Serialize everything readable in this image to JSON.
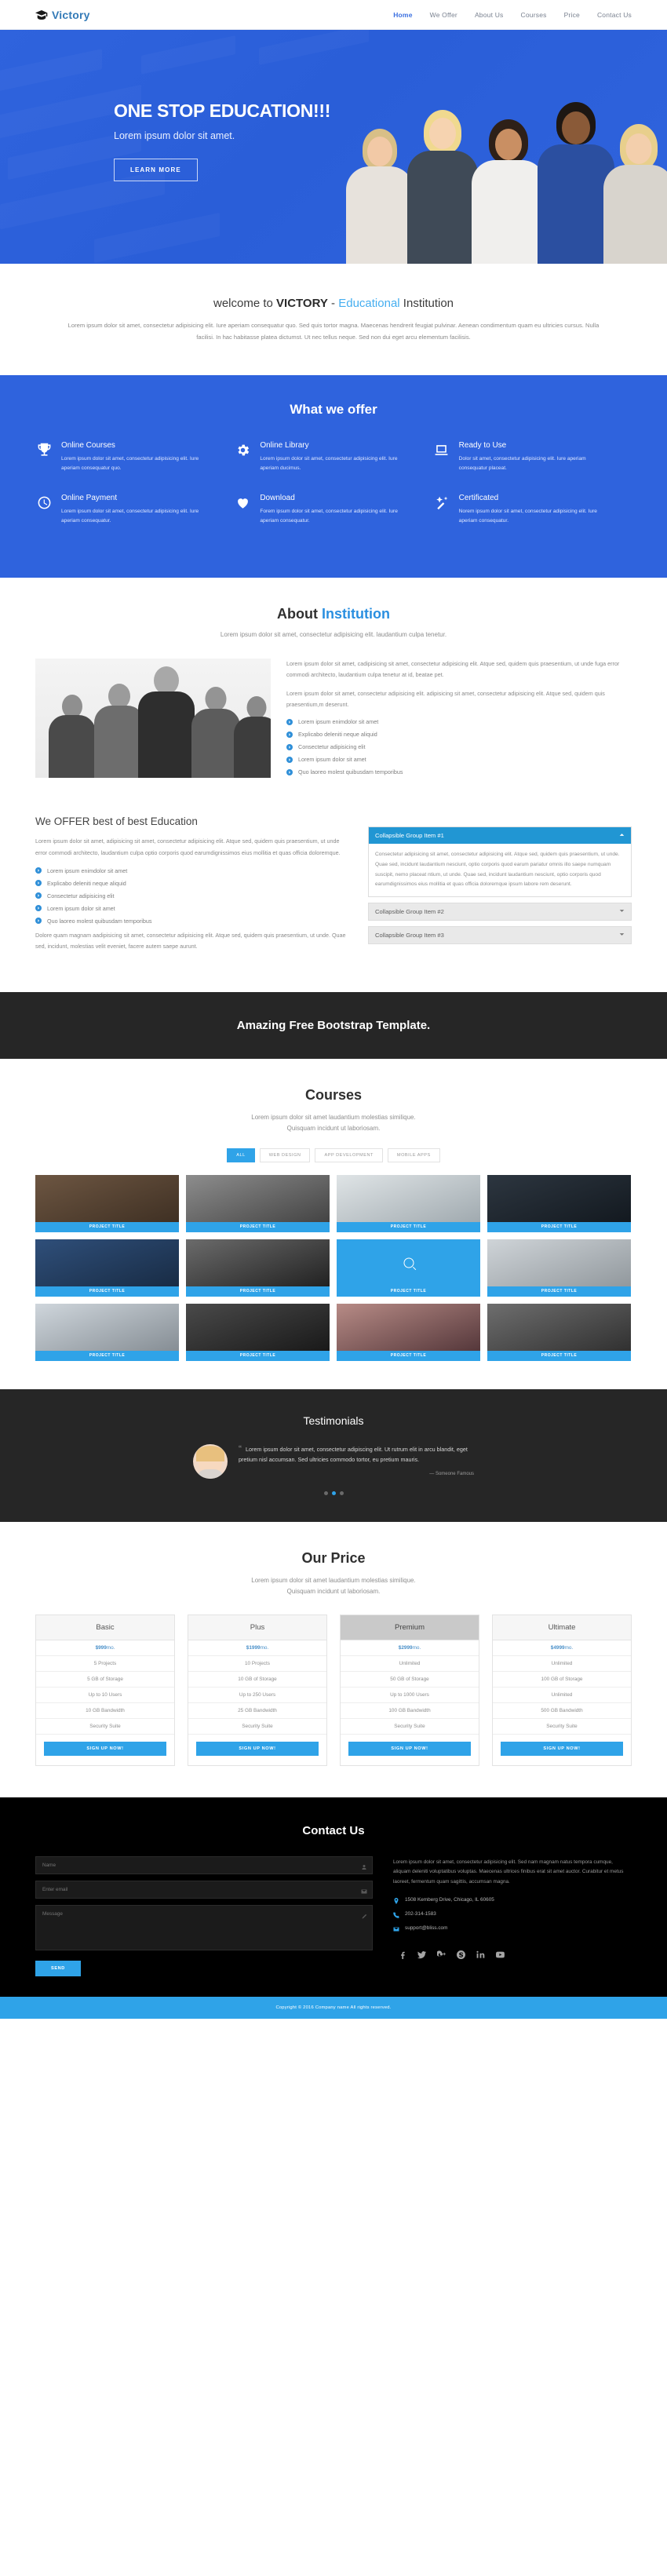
{
  "nav": {
    "brand": "Victory",
    "brand_icon": "graduation-cap-icon",
    "links": [
      {
        "label": "Home",
        "active": true
      },
      {
        "label": "We Offer",
        "active": false
      },
      {
        "label": "About Us",
        "active": false
      },
      {
        "label": "Courses",
        "active": false
      },
      {
        "label": "Price",
        "active": false
      },
      {
        "label": "Contact Us",
        "active": false
      }
    ]
  },
  "hero": {
    "title": "ONE STOP EDUCATION!!!",
    "subtitle": "Lorem ipsum dolor sit amet.",
    "button": "LEARN MORE",
    "bg_color": "#2f63dd"
  },
  "welcome": {
    "title_pre": "welcome to ",
    "title_bold": "VICTORY",
    "title_dash": " - ",
    "title_accent": "Educational",
    "title_post": " Institution",
    "paragraph": "Lorem ipsum dolor sit amet, consectetur adipisicing elit. Iure aperiam consequatur quo. Sed quis tortor magna. Maecenas hendrerit feugiat pulvinar. Aenean condimentum quam eu ultricies cursus. Nulla facilisi. In hac habitasse platea dictumst. Ut nec tellus neque. Sed non dui eget arcu elementum facilisis."
  },
  "offer": {
    "title": "What we offer",
    "items": [
      {
        "icon": "trophy-icon",
        "title": "Online Courses",
        "text": "Lorem ipsum dolor sit amet, consectetur adipisicing elit. Iure aperiam consequatur quo."
      },
      {
        "icon": "gear-icon",
        "title": "Online Library",
        "text": "Lorem ipsum dolor sit amet, consectetur adipisicing elit. Iure aperiam ducimus."
      },
      {
        "icon": "laptop-icon",
        "title": "Ready to Use",
        "text": "Dolor sit amet, consectetur adipisicing elit. Iure aperiam consequatur placeat."
      },
      {
        "icon": "clock-icon",
        "title": "Online Payment",
        "text": "Lorem ipsum dolor sit amet, consectetur adipisicing elit. Iure aperiam consequatur."
      },
      {
        "icon": "heart-icon",
        "title": "Download",
        "text": "Forem ipsum dolor sit amet, consectetur adipisicing elit. Iure aperiam consequatur."
      },
      {
        "icon": "magic-wand-icon",
        "title": "Certificated",
        "text": "Norem ipsum dolor sit amet, consectetur adipisicing elit. Iure aperiam consequatur."
      }
    ]
  },
  "about": {
    "title_pre": "About ",
    "title_accent": "Institution",
    "lead": "Lorem ipsum dolor sit amet, consectetur adipisicing elit. laudantium culpa tenetur.",
    "paragraph1": "Lorem ipsum dolor sit amet, cadipisicing sit amet, consectetur adipisicing elit. Atque sed, quidem quis praesentium, ut unde fuga error commodi architecto, laudantium culpa tenetur at id, beatae pet.",
    "paragraph2": "Lorem ipsum dolor sit amet, consectetur adipisicing elit. adipisicing sit amet, consectetur adipisicing elit. Atque sed, quidem quis praesentium,m deserunt.",
    "bullets": [
      "Lorem ipsum enimdolor sit amet",
      "Explicabo deleniti neque aliquid",
      "Consectetur adipisicing elit",
      "Lorem ipsum dolor sit amet",
      "Quo laoreo molest quibusdam temporibus"
    ]
  },
  "best": {
    "title": "We OFFER best of best Education",
    "paragraph1": "Lorem ipsum dolor sit amet, adipisicing sit amet, consectetur adipisicing elit. Atque sed, quidem quis praesentium, ut unde error commodi architecto, laudantium culpa optio corporis quod earumdignissimos eius mollitia et quas officia doloremque.",
    "bullets": [
      "Lorem ipsum enimdolor sit amet",
      "Explicabo deleniti neque aliquid",
      "Consectetur adipisicing elit",
      "Lorem ipsum dolor sit amet",
      "Quo laoreo molest quibusdam temporibus"
    ],
    "paragraph2": "Dolore quam magnam aadipisicing sit amet, consectetur adipisicing elit. Atque sed, quidem quis praesentium, ut unde. Quae sed, incidunt, molestias velit eveniet, facere autem saepe aurunt.",
    "accordion": [
      {
        "title": "Collapsible Group Item #1",
        "open": true,
        "body": "Consectetur adipisicing sit amet, consectetur adipisicing elit. Atque sed, quidem quis praesentium, ut unde. Quae sed, incidunt laudantium nesciunt, optio corporis quod earum pariatur omnis illo saepe numquam suscipit, nemo placeat ntium, ut unde. Quae sed, incidunt laudantium nesciunt, optio corporis quod earumdignissimos eius mollitia et quas officia doloremque ipsum labore rem deserunt."
      },
      {
        "title": "Collapsible Group Item #2",
        "open": false,
        "body": ""
      },
      {
        "title": "Collapsible Group Item #3",
        "open": false,
        "body": ""
      }
    ]
  },
  "cta": {
    "title": "Amazing Free Bootstrap Template."
  },
  "courses": {
    "title": "Courses",
    "lead_line1": "Lorem ipsum dolor sit amet laudantium molestias similique.",
    "lead_line2": "Quisquam incidunt ut laboriosam.",
    "filters": [
      {
        "label": "ALL",
        "active": true
      },
      {
        "label": "WEB DESIGN",
        "active": false
      },
      {
        "label": "APP DEVELOPMENT",
        "active": false
      },
      {
        "label": "MOBILE APPS",
        "active": false
      }
    ],
    "caption": "PROJECT TITLE",
    "items": [
      {
        "caption": "PROJECT TITLE",
        "hover": false
      },
      {
        "caption": "PROJECT TITLE",
        "hover": false
      },
      {
        "caption": "PROJECT TITLE",
        "hover": false
      },
      {
        "caption": "PROJECT TITLE",
        "hover": false
      },
      {
        "caption": "PROJECT TITLE",
        "hover": false
      },
      {
        "caption": "PROJECT TITLE",
        "hover": false
      },
      {
        "caption": "PROJECT TITLE",
        "hover": true
      },
      {
        "caption": "PROJECT TITLE",
        "hover": false
      },
      {
        "caption": "PROJECT TITLE",
        "hover": false
      },
      {
        "caption": "PROJECT TITLE",
        "hover": false
      },
      {
        "caption": "PROJECT TITLE",
        "hover": false
      },
      {
        "caption": "PROJECT TITLE",
        "hover": false
      }
    ]
  },
  "testimonials": {
    "title": "Testimonials",
    "quote": "Lorem ipsum dolor sit amet, consectetur adipiscing elit. Ut rutrum elit in arcu blandit, eget pretium nisl accumsan. Sed ultricies commodo tortor, eu pretium mauris.",
    "author": "— Someone Famous",
    "dots": [
      false,
      true,
      false
    ]
  },
  "price": {
    "title": "Our Price",
    "lead_line1": "Lorem ipsum dolor sit amet laudantium molestias similique.",
    "lead_line2": "Quisquam incidunt ut laboriosam.",
    "button": "SIGN UP NOW!",
    "plans": [
      {
        "name": "Basic",
        "featured": false,
        "price": "$999",
        "price_suffix": "mo.",
        "rows": [
          "5 Projects",
          "5 GB of Storage",
          "Up to 10 Users",
          "10 GB Bandwidth",
          "Security Suite"
        ]
      },
      {
        "name": "Plus",
        "featured": false,
        "price": "$1999",
        "price_suffix": "mo.",
        "rows": [
          "10 Projects",
          "10 GB of Storage",
          "Up to 250 Users",
          "25 GB Bandwidth",
          "Security Suite"
        ]
      },
      {
        "name": "Premium",
        "featured": true,
        "price": "$2999",
        "price_suffix": "mo.",
        "rows": [
          "Unlimited",
          "50 GB of Storage",
          "Up to 1000 Users",
          "100 GB Bandwidth",
          "Security Suite"
        ]
      },
      {
        "name": "Ultimate",
        "featured": false,
        "price": "$4999",
        "price_suffix": "mo.",
        "rows": [
          "Unlimited",
          "100 GB of Storage",
          "Unlimited",
          "500 GB Bandwidth",
          "Security Suite"
        ]
      }
    ]
  },
  "contact": {
    "title": "Contact Us",
    "name_placeholder": "Name",
    "email_placeholder": "Enter email",
    "message_placeholder": "Message",
    "send_label": "SEND",
    "paragraph": "Lorem ipsum dolor sit amet, consectetur adipisicing elit. Sed nam magnam natus tempora cumque, aliquam deleniti voluptatibus voluptas. Maecenas ultrices finibus erat sit amet auctor. Curabitur et metus laoreet, fermentum quam sagittis, accumsan magna.",
    "address": "1508 Kemberg Drive, Chicago, IL 60605",
    "phone": "202-314-1583",
    "email": "support@bliss.com",
    "socials": [
      "facebook-icon",
      "twitter-icon",
      "google-plus-icon",
      "skype-icon",
      "linkedin-icon",
      "youtube-icon"
    ]
  },
  "footer": {
    "text": "Copyright © 2016 Company name All rights reserved."
  },
  "colors": {
    "brand_blue": "#337ab7",
    "hero_blue": "#2f63dd",
    "accent_cyan": "#2fa3e8",
    "dark": "#262626",
    "black": "#000000"
  }
}
